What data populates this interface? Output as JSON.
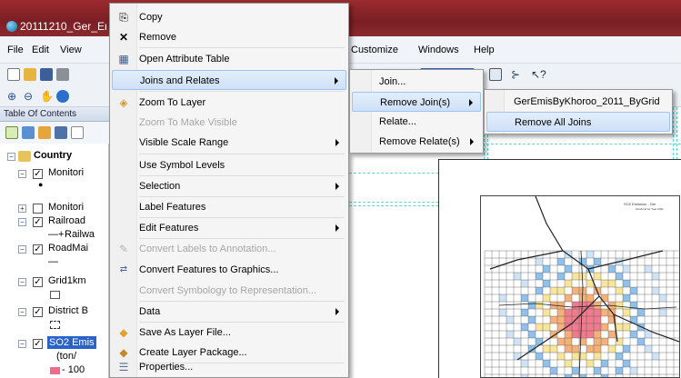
{
  "window": {
    "title": "20111210_Ger_Er"
  },
  "menubar": {
    "items": [
      "File",
      "Edit",
      "View",
      "Customize",
      "Windows",
      "Help"
    ]
  },
  "toc": {
    "header": "Table Of Contents",
    "rows": [
      {
        "label": "Country",
        "bold": true
      },
      {
        "label": "Monitori"
      },
      {
        "label": "Monitori"
      },
      {
        "label": "Railroad"
      },
      {
        "label": "Railwa"
      },
      {
        "label": "RoadMai"
      },
      {
        "label": "Grid1km"
      },
      {
        "label": "District B"
      },
      {
        "label": "SO2 Emis"
      },
      {
        "label": "(ton/"
      },
      {
        "label": "- 100"
      }
    ]
  },
  "context_menu": {
    "items": [
      {
        "label": "Copy",
        "icon": "copy-icon"
      },
      {
        "label": "Remove",
        "icon": "remove-x-icon"
      },
      {
        "label": "Open Attribute Table",
        "icon": "table-icon"
      },
      {
        "label": "Joins and Relates",
        "submenu": true,
        "highlighted": true
      },
      {
        "label": "Zoom To Layer",
        "icon": "zoom-layer-icon"
      },
      {
        "label": "Zoom To Make Visible",
        "disabled": true
      },
      {
        "label": "Visible Scale Range",
        "submenu": true
      },
      {
        "label": "Use Symbol Levels"
      },
      {
        "label": "Selection",
        "submenu": true
      },
      {
        "label": "Label Features"
      },
      {
        "label": "Edit Features",
        "submenu": true
      },
      {
        "label": "Convert Labels to Annotation...",
        "disabled": true
      },
      {
        "label": "Convert Features to Graphics...",
        "icon": "convert-graphics-icon"
      },
      {
        "label": "Convert Symbology to Representation...",
        "disabled": true
      },
      {
        "label": "Data",
        "submenu": true
      },
      {
        "label": "Save As Layer File...",
        "icon": "layer-file-icon"
      },
      {
        "label": "Create Layer Package...",
        "icon": "layer-package-icon"
      },
      {
        "label": "Properties...",
        "icon": "properties-icon"
      }
    ]
  },
  "joins_submenu": {
    "items": [
      {
        "label": "Join..."
      },
      {
        "label": "Remove Join(s)",
        "submenu": true,
        "highlighted": true
      },
      {
        "label": "Relate..."
      },
      {
        "label": "Remove Relate(s)",
        "submenu": true
      }
    ]
  },
  "remove_join_submenu": {
    "items": [
      {
        "label": "GerEmisByKhoroo_2011_ByGrid"
      },
      {
        "label": "Remove All Joins",
        "highlighted": true
      }
    ]
  },
  "layout": {
    "map_title": "SO2 Emission - Ger",
    "map_subtitle": "tons/km2 for Year 2011"
  },
  "colors": {
    "highlight_border": "#9ec3ee",
    "title_bar": "#8a2a2e",
    "guide_lines": "#5fd3d3"
  }
}
